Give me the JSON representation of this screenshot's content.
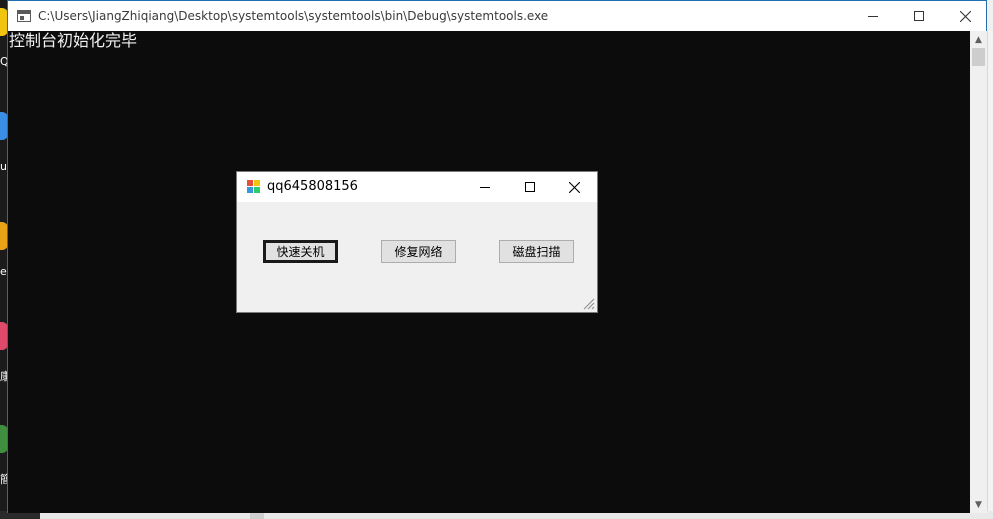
{
  "console_window": {
    "title": "C:\\Users\\JiangZhiqiang\\Desktop\\systemtools\\systemtools\\bin\\Debug\\systemtools.exe",
    "output": "控制台初始化完毕",
    "icons": {
      "app": "console-icon",
      "minimize": "minimize-icon",
      "maximize": "maximize-icon",
      "close": "close-icon"
    }
  },
  "form_window": {
    "title": "qq645808156",
    "buttons": {
      "shutdown": "快速关机",
      "repair_network": "修复网络",
      "disk_scan": "磁盘扫描"
    }
  },
  "desktop": {
    "partial_labels": [
      "Q",
      "u",
      "e",
      "康",
      "簡"
    ]
  },
  "colors": {
    "console_bg": "#0c0c0c",
    "console_text": "#f2f2f2",
    "form_bg": "#f0f0f0",
    "button_bg": "#e1e1e1",
    "window_border": "#1f6fb2"
  }
}
